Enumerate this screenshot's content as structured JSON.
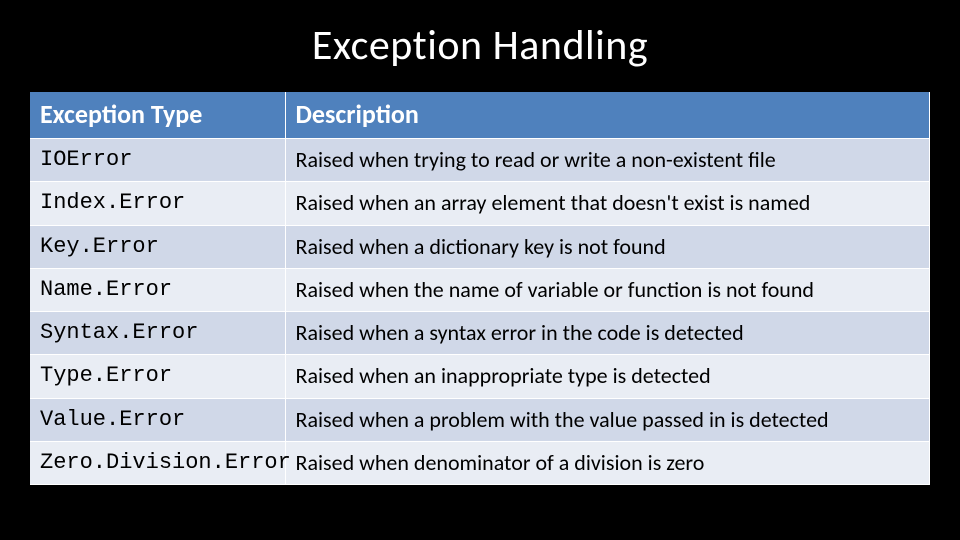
{
  "title": "Exception Handling",
  "table": {
    "headers": {
      "type": "Exception Type",
      "desc": "Description"
    },
    "rows": [
      {
        "type": "IOError",
        "desc": "Raised when trying to read or write a non-existent file"
      },
      {
        "type": "Index.Error",
        "desc": "Raised when an array element that doesn't exist is named"
      },
      {
        "type": "Key.Error",
        "desc": "Raised when a dictionary key is not found"
      },
      {
        "type": "Name.Error",
        "desc": "Raised when the name of variable or function is not found"
      },
      {
        "type": "Syntax.Error",
        "desc": "Raised when a syntax error in the code is detected"
      },
      {
        "type": "Type.Error",
        "desc": "Raised when an inappropriate type is detected"
      },
      {
        "type": "Value.Error",
        "desc": "Raised when a problem with the value passed in is detected"
      },
      {
        "type": "Zero.Division.Error",
        "desc": "Raised when denominator of a division is zero"
      }
    ]
  }
}
